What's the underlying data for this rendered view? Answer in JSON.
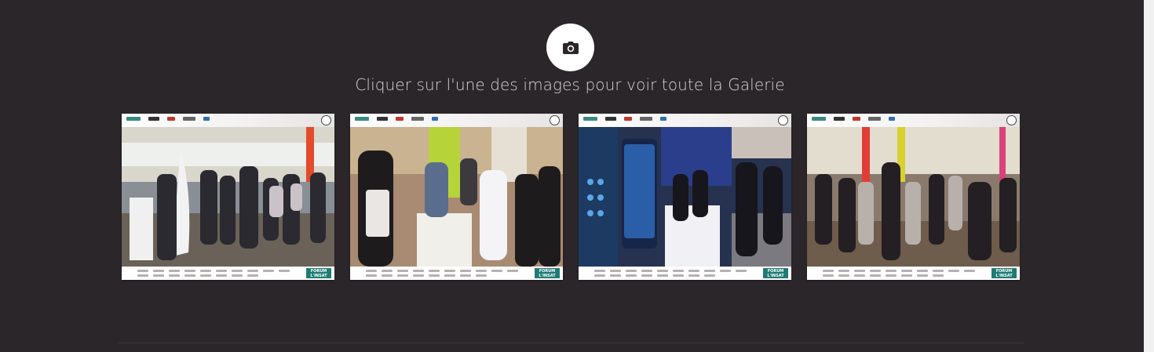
{
  "gallery": {
    "icon": "camera-icon",
    "caption": "Cliquer sur l'une des images pour voir toute la Galerie",
    "thumbnails": [
      {
        "alt": "photo-1",
        "footer_badge": "FORUM L'INSAT"
      },
      {
        "alt": "photo-2",
        "footer_badge": "FORUM L'INSAT"
      },
      {
        "alt": "photo-3",
        "footer_badge": "FORUM L'INSAT"
      },
      {
        "alt": "photo-4",
        "footer_badge": "FORUM L'INSAT"
      }
    ]
  },
  "colors": {
    "background": "#2b262a",
    "caption": "#d8d3d7",
    "accent": "#1f7b73"
  }
}
